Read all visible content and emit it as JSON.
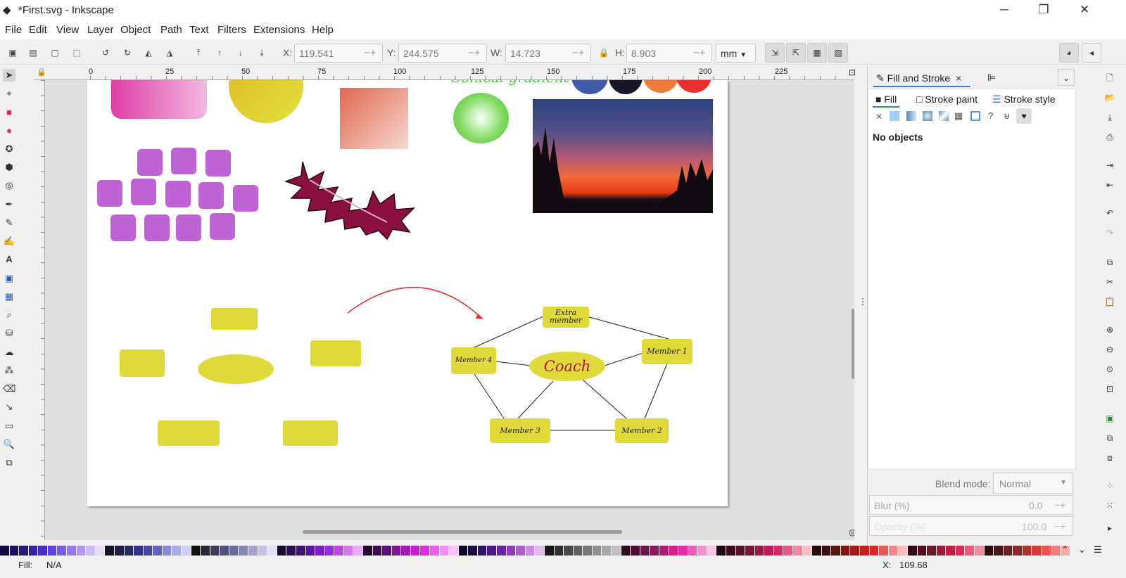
{
  "window": {
    "title": "*First.svg - Inkscape",
    "minimize": "─",
    "maximize": "❐",
    "close": "✕"
  },
  "menu": [
    "File",
    "Edit",
    "View",
    "Layer",
    "Object",
    "Path",
    "Text",
    "Filters",
    "Extensions",
    "Help"
  ],
  "toolbar": {
    "x_label": "X:",
    "x_value": "119.541",
    "y_label": "Y:",
    "y_value": "244.575",
    "w_label": "W:",
    "w_value": "14.723",
    "h_label": "H:",
    "h_value": "8.903",
    "unit": "mm"
  },
  "ruler": {
    "ticks": [
      "0",
      "25",
      "50",
      "75",
      "100",
      "125",
      "150",
      "175",
      "200",
      "225"
    ]
  },
  "canvas": {
    "gradient_text": "Conical gradient",
    "diagram": {
      "coach": "Coach",
      "extra": "Extra member",
      "m1": "Member 1",
      "m2": "Member 2",
      "m3": "Member 3",
      "m4": "Member 4"
    }
  },
  "panel": {
    "tab_fill_stroke": "Fill and Stroke",
    "tab_close": "×",
    "subtabs": [
      "Fill",
      "Stroke paint",
      "Stroke style"
    ],
    "no_objects": "No objects",
    "blend_label": "Blend mode:",
    "blend_value": "Normal",
    "blur_label": "Blur (%)",
    "blur_value": "0.0",
    "opacity_label": "Opacity (%)",
    "opacity_value": "100.0"
  },
  "status": {
    "fill_label": "Fill:",
    "fill_value": "N/A",
    "x_label": "X:",
    "x_value": "109.68"
  },
  "colors": {
    "accent": "#3a7bd5",
    "node_fill": "#dfd93a",
    "square_fill": "#bf62d4",
    "arrow": "#e03030",
    "coach_text": "#b0103a"
  },
  "palette": [
    "#140a3c",
    "#1e1060",
    "#2a1880",
    "#3a20a8",
    "#4a2cc8",
    "#6040e0",
    "#7a5ae8",
    "#9478ee",
    "#b098f2",
    "#ccbcf6",
    "#e6dcfa",
    "#141428",
    "#1e1e46",
    "#282866",
    "#323286",
    "#4646a6",
    "#6464c0",
    "#8888d4",
    "#ababe4",
    "#d0d0f0",
    "#101010",
    "#262636",
    "#3c3c5a",
    "#50507c",
    "#6a6a9c",
    "#8686b6",
    "#a4a4cc",
    "#c2c2e0",
    "#e0e0f0",
    "#1a0a32",
    "#2c0e58",
    "#40127e",
    "#5c16a6",
    "#7a1ec8",
    "#9a2ae0",
    "#bc46ea",
    "#d478f0",
    "#e8aaf6",
    "#24082e",
    "#3e0c50",
    "#5a1076",
    "#7c1498",
    "#a01ab8",
    "#c420d2",
    "#e02ae6",
    "#ee5cf0",
    "#f68ef6",
    "#fac4fa",
    "#100828",
    "#1e0c46",
    "#341466",
    "#4c1c84",
    "#6a28a0",
    "#8c3cbc",
    "#ae5ed2",
    "#cc88e2",
    "#e6b8f0",
    "#181818",
    "#303030",
    "#484848",
    "#606060",
    "#787878",
    "#909090",
    "#a8a8a8",
    "#c0c0c0",
    "#2e0a1e",
    "#4c0e32",
    "#6e1248",
    "#90165e",
    "#b21a74",
    "#d2208a",
    "#ea2aa2",
    "#f05cba",
    "#f68ed0",
    "#fac2e6",
    "#200810",
    "#3a0c1c",
    "#58102a",
    "#7a1438",
    "#9c1848",
    "#be1c58",
    "#de246a",
    "#ec5484",
    "#f486a2",
    "#fabcc6",
    "#240a0a",
    "#3e0e0e",
    "#5e1212",
    "#801616",
    "#a21a1a",
    "#c41e1e",
    "#e02626",
    "#ec5656",
    "#f48888",
    "#fabcbc",
    "#300a14",
    "#50101e",
    "#74162a",
    "#9a1c38",
    "#c02046",
    "#e02a56",
    "#ee5a7a",
    "#f68ca0",
    "#2a1010",
    "#481818",
    "#6a2020",
    "#8e2828",
    "#b23030",
    "#d43a3a",
    "#ec5050",
    "#f47c7c",
    "#faacac"
  ]
}
